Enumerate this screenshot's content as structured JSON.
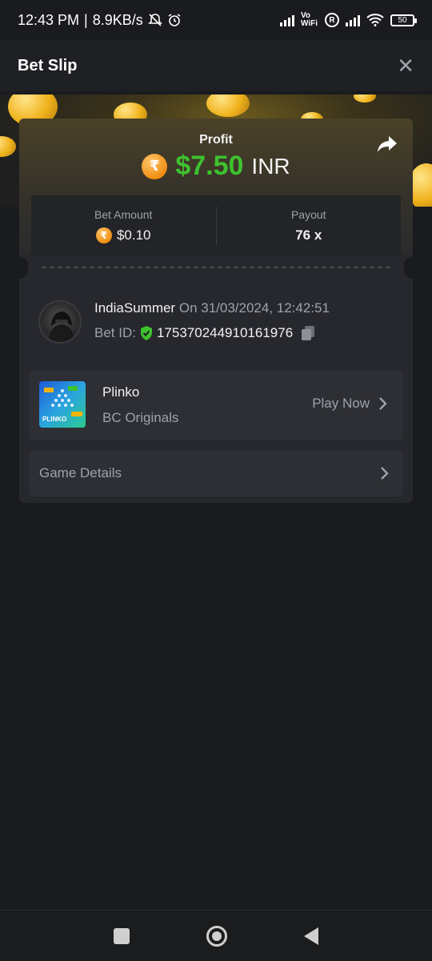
{
  "status_bar": {
    "time": "12:43 PM",
    "net_speed": "8.9KB/s",
    "vowifi": "Vo WiFi",
    "r_badge": "R",
    "battery": "50",
    "icons": [
      "mute-bell-icon",
      "alarm-icon",
      "signal-icon",
      "vowifi-icon",
      "r-icon",
      "signal-icon",
      "wifi-icon",
      "battery-icon"
    ]
  },
  "header": {
    "title": "Bet Slip",
    "close_label": "✕"
  },
  "profit": {
    "label": "Profit",
    "currency_symbol": "₹",
    "amount": "$7.50",
    "currency": "INR",
    "color": "#3ec12f"
  },
  "bet_summary": {
    "bet_amount_label": "Bet Amount",
    "bet_amount_symbol": "₹",
    "bet_amount_value": "$0.10",
    "payout_label": "Payout",
    "payout_value": "76 x"
  },
  "user": {
    "name": "IndiaSummer",
    "date": "On 31/03/2024, 12:42:51",
    "bet_id_label": "Bet ID:",
    "bet_id": "175370244910161976"
  },
  "game": {
    "name": "Plinko",
    "provider": "BC Originals",
    "thumb_text": "PLINKO",
    "play_label": "Play Now"
  },
  "details": {
    "label": "Game Details"
  }
}
